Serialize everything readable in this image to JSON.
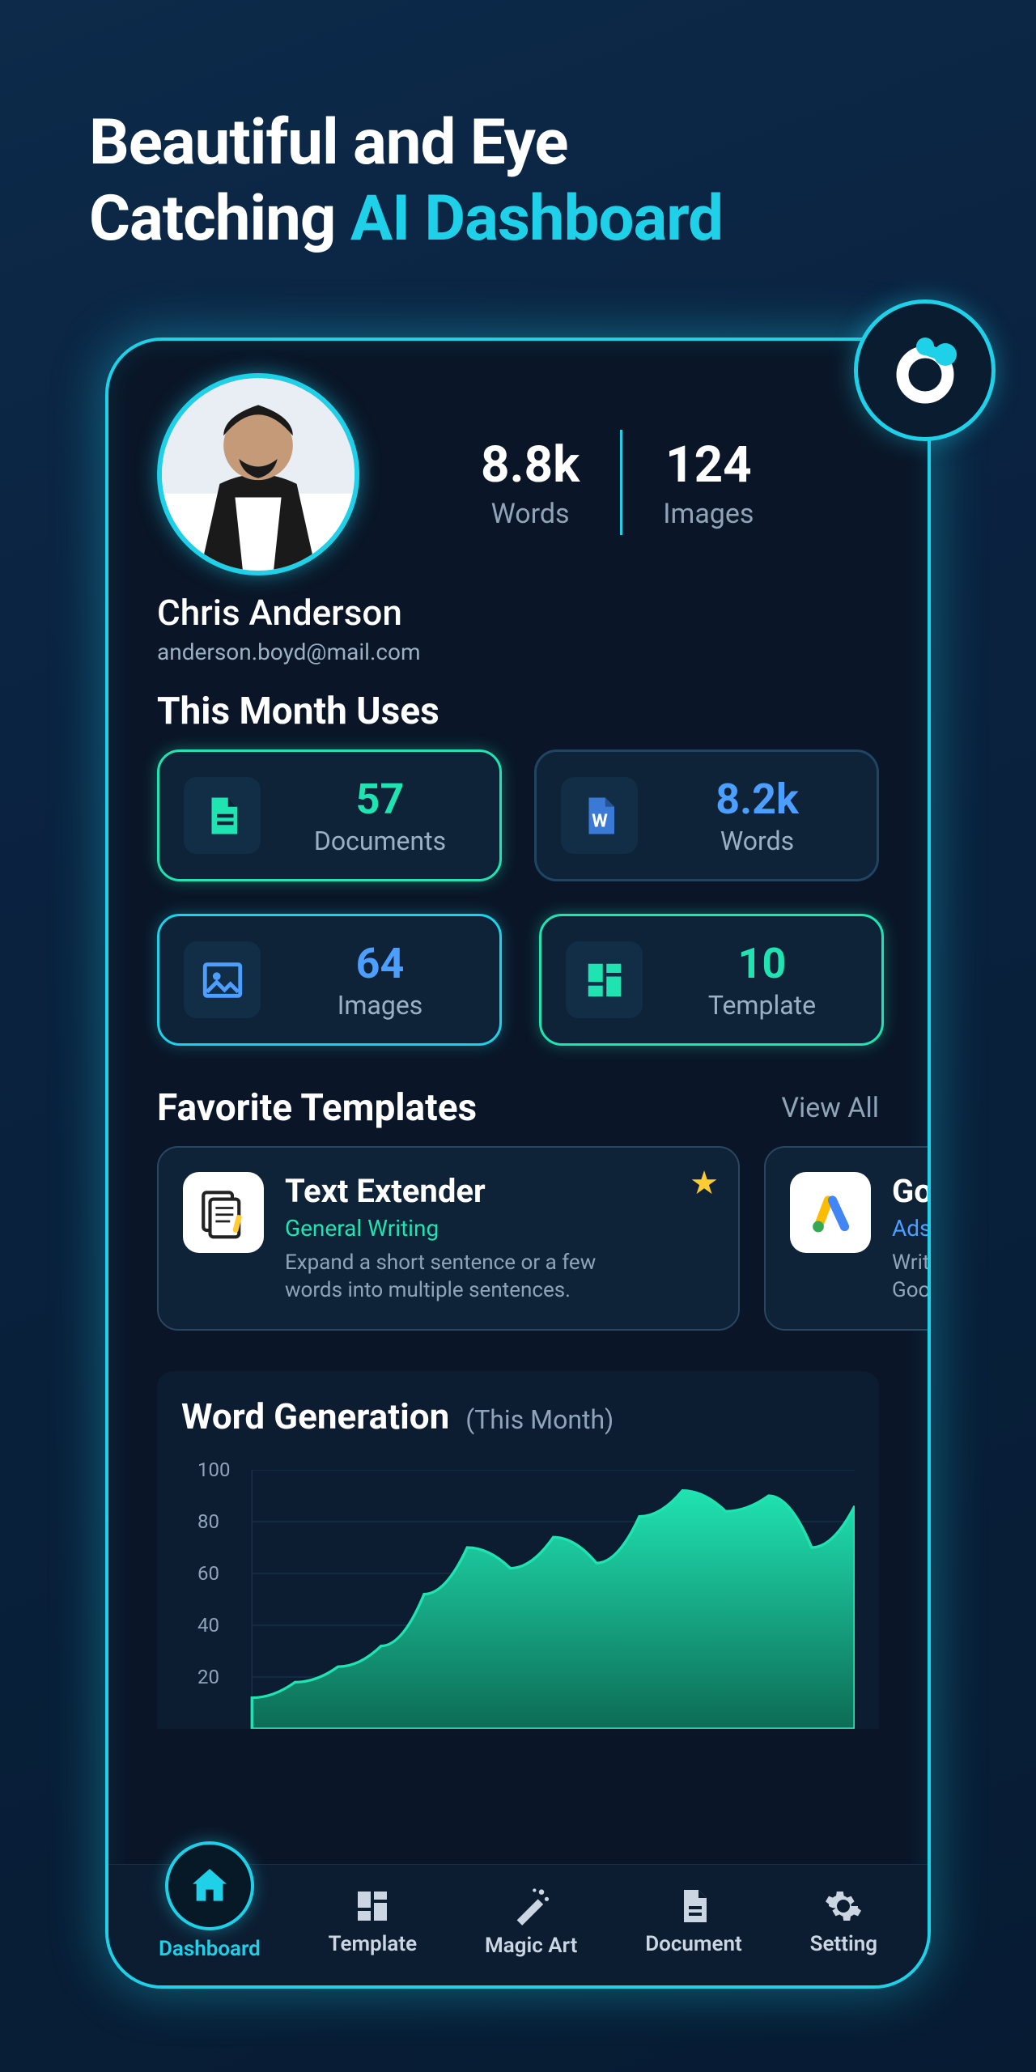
{
  "hero": {
    "line1": "Beautiful and Eye",
    "line2a": "Catching",
    "line2b": "AI Dashboard"
  },
  "user": {
    "name": "Chris Anderson",
    "email": "anderson.boyd@mail.com"
  },
  "top_stats": {
    "words": {
      "value": "8.8k",
      "label": "Words"
    },
    "images": {
      "value": "124",
      "label": "Images"
    }
  },
  "section_month_uses": "This Month Uses",
  "usage": [
    {
      "value": "57",
      "label": "Documents",
      "color": "green",
      "highlight": "green",
      "icon": "doc"
    },
    {
      "value": "8.2k",
      "label": "Words",
      "color": "blue",
      "highlight": "",
      "icon": "word"
    },
    {
      "value": "64",
      "label": "Images",
      "color": "blue",
      "highlight": "blue",
      "icon": "image"
    },
    {
      "value": "10",
      "label": "Template",
      "color": "green",
      "highlight": "green",
      "icon": "grid"
    }
  ],
  "fav": {
    "title": "Favorite Templates",
    "view_all": "View All"
  },
  "templates": [
    {
      "title": "Text Extender",
      "category": "General Writing",
      "desc": "Expand a short sentence or a few words into multiple sentences.",
      "starred": true
    },
    {
      "title": "Go",
      "category": "Ads a",
      "desc": "Writ\nGoog"
    }
  ],
  "chart": {
    "title": "Word Generation",
    "sub": "(This Month)"
  },
  "chart_data": {
    "type": "area",
    "title": "Word Generation",
    "subtitle": "(This Month)",
    "xlabel": "",
    "ylabel": "",
    "ylim": [
      0,
      100
    ],
    "yticks": [
      20,
      40,
      60,
      80,
      100
    ],
    "x": [
      1,
      2,
      3,
      4,
      5,
      6,
      7,
      8,
      9,
      10,
      11,
      12,
      13,
      14,
      15
    ],
    "values": [
      12,
      18,
      24,
      32,
      52,
      70,
      62,
      74,
      64,
      82,
      92,
      84,
      90,
      70,
      86
    ]
  },
  "nav": [
    {
      "label": "Dashboard",
      "icon": "home",
      "active": true
    },
    {
      "label": "Template",
      "icon": "grid",
      "active": false
    },
    {
      "label": "Magic Art",
      "icon": "wand",
      "active": false
    },
    {
      "label": "Document",
      "icon": "doc",
      "active": false
    },
    {
      "label": "Setting",
      "icon": "gear",
      "active": false
    }
  ]
}
